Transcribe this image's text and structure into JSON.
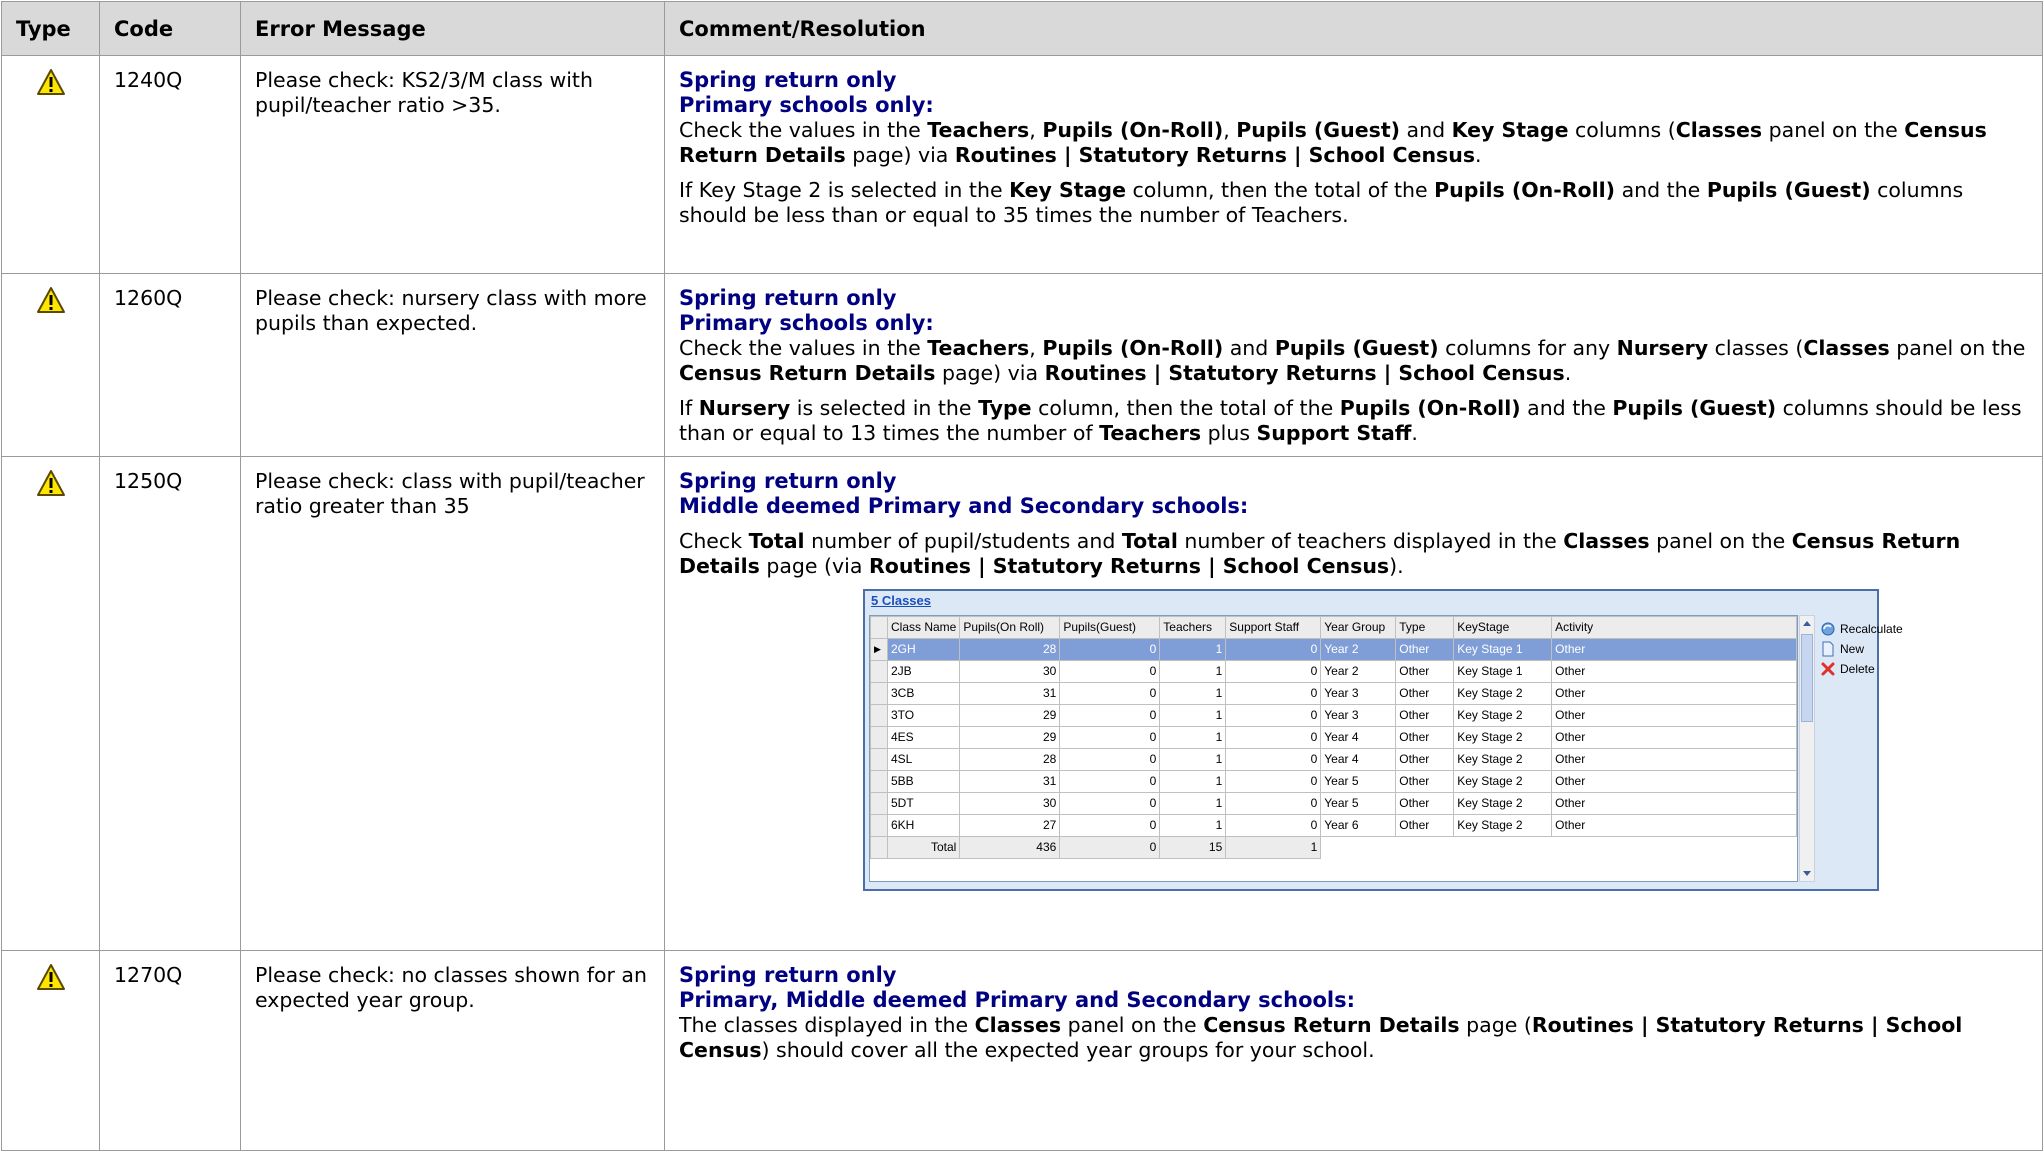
{
  "headers": [
    "Type",
    "Code",
    "Error Message",
    "Comment/Resolution"
  ],
  "icons": {
    "warning": "warning-triangle-icon"
  },
  "colors": {
    "heading": "#000080",
    "header_bg": "#d9d9d9",
    "warning_fill": "#ffe600"
  },
  "rows": [
    {
      "code": "1240Q",
      "message": "Please check: KS2/3/M class with pupil/teacher ratio >35.",
      "heading1": "Spring return only",
      "heading2": "Primary schools only:",
      "p1": [
        {
          "t": "Check the values in the "
        },
        {
          "b": "Teachers"
        },
        {
          "t": ", "
        },
        {
          "b": "Pupils (On-Roll)"
        },
        {
          "t": ", "
        },
        {
          "b": "Pupils (Guest)"
        },
        {
          "t": " and "
        },
        {
          "b": "Key Stage"
        },
        {
          "t": " columns ("
        },
        {
          "b": "Classes"
        },
        {
          "t": " panel on the "
        },
        {
          "b": "Census Return Details"
        },
        {
          "t": " page) via "
        },
        {
          "b": "Routines | Statutory Returns | School Census"
        },
        {
          "t": "."
        }
      ],
      "p2": [
        {
          "t": "If Key Stage 2 is selected in the "
        },
        {
          "b": "Key Stage"
        },
        {
          "t": " column, then the total of the "
        },
        {
          "b": "Pupils (On-Roll)"
        },
        {
          "t": " and the "
        },
        {
          "b": "Pupils (Guest)"
        },
        {
          "t": " columns should be less than or equal to 35 times the number of Teachers."
        }
      ]
    },
    {
      "code": "1260Q",
      "message": "Please check: nursery class with more pupils than expected.",
      "heading1": "Spring return only",
      "heading2": "Primary schools only:",
      "p1": [
        {
          "t": "Check the values in the "
        },
        {
          "b": "Teachers"
        },
        {
          "t": ", "
        },
        {
          "b": "Pupils (On-Roll)"
        },
        {
          "t": " and "
        },
        {
          "b": "Pupils (Guest)"
        },
        {
          "t": " columns for any "
        },
        {
          "b": "Nursery"
        },
        {
          "t": " classes ("
        },
        {
          "b": "Classes"
        },
        {
          "t": " panel on the "
        },
        {
          "b": "Census Return Details"
        },
        {
          "t": " page) via "
        },
        {
          "b": "Routines | Statutory Returns | School Census"
        },
        {
          "t": "."
        }
      ],
      "p2": [
        {
          "t": "If "
        },
        {
          "b": "Nursery"
        },
        {
          "t": " is selected in the "
        },
        {
          "b": "Type"
        },
        {
          "t": " column, then the total of the "
        },
        {
          "b": "Pupils (On-Roll)"
        },
        {
          "t": " and the "
        },
        {
          "b": "Pupils (Guest)"
        },
        {
          "t": " columns should be less than or equal to 13 times the number of "
        },
        {
          "b": "Teachers"
        },
        {
          "t": " plus "
        },
        {
          "b": "Support Staff"
        },
        {
          "t": "."
        }
      ]
    },
    {
      "code": "1250Q",
      "message": "Please check: class with pupil/teacher ratio greater than 35",
      "heading1": "Spring return only",
      "heading2": "Middle deemed Primary and Secondary schools:",
      "p1": [
        {
          "t": "Check "
        },
        {
          "b": "Total"
        },
        {
          "t": " number of pupil/students and "
        },
        {
          "b": "Total"
        },
        {
          "t": " number of teachers displayed in the "
        },
        {
          "b": "Classes"
        },
        {
          "t": " panel on the "
        },
        {
          "b": "Census Return Details"
        },
        {
          "t": " page (via "
        },
        {
          "b": "Routines | Statutory Returns | School Census"
        },
        {
          "t": ")."
        }
      ]
    },
    {
      "code": "1270Q",
      "message": "Please check: no classes shown for an expected year group.",
      "heading1": "Spring return only",
      "heading2": "Primary, Middle deemed Primary and Secondary schools:",
      "p1": [
        {
          "t": "The classes displayed in the "
        },
        {
          "b": "Classes"
        },
        {
          "t": " panel on the "
        },
        {
          "b": "Census Return Details"
        },
        {
          "t": " page ("
        },
        {
          "b": "Routines | Statutory Returns | School Census"
        },
        {
          "t": ") should cover all the expected year groups for your school."
        }
      ]
    }
  ],
  "classes_panel": {
    "title": "5 Classes",
    "columns": [
      "Class Name",
      "Pupils(On Roll)",
      "Pupils(Guest)",
      "Teachers",
      "Support Staff",
      "Year Group",
      "Type",
      "KeyStage",
      "Activity"
    ],
    "rows": [
      [
        "2GH",
        "28",
        "0",
        "1",
        "0",
        "Year 2",
        "Other",
        "Key Stage 1",
        "Other"
      ],
      [
        "2JB",
        "30",
        "0",
        "1",
        "0",
        "Year 2",
        "Other",
        "Key Stage 1",
        "Other"
      ],
      [
        "3CB",
        "31",
        "0",
        "1",
        "0",
        "Year 3",
        "Other",
        "Key Stage 2",
        "Other"
      ],
      [
        "3TO",
        "29",
        "0",
        "1",
        "0",
        "Year 3",
        "Other",
        "Key Stage 2",
        "Other"
      ],
      [
        "4ES",
        "29",
        "0",
        "1",
        "0",
        "Year 4",
        "Other",
        "Key Stage 2",
        "Other"
      ],
      [
        "4SL",
        "28",
        "0",
        "1",
        "0",
        "Year 4",
        "Other",
        "Key Stage 2",
        "Other"
      ],
      [
        "5BB",
        "31",
        "0",
        "1",
        "0",
        "Year 5",
        "Other",
        "Key Stage 2",
        "Other"
      ],
      [
        "5DT",
        "30",
        "0",
        "1",
        "0",
        "Year 5",
        "Other",
        "Key Stage 2",
        "Other"
      ],
      [
        "6KH",
        "27",
        "0",
        "1",
        "0",
        "Year 6",
        "Other",
        "Key Stage 2",
        "Other"
      ]
    ],
    "selected_row": 0,
    "total_label": "Total",
    "totals": [
      "436",
      "0",
      "15",
      "1"
    ],
    "actions": [
      {
        "label": "Recalculate",
        "icon": "recalculate-icon"
      },
      {
        "label": "New",
        "icon": "new-document-icon"
      },
      {
        "label": "Delete",
        "icon": "delete-x-icon"
      }
    ]
  }
}
